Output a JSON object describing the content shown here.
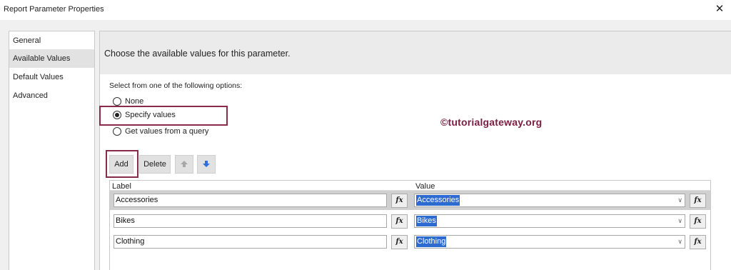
{
  "window": {
    "title": "Report Parameter Properties",
    "close_glyph": "✕"
  },
  "nav": {
    "items": [
      {
        "label": "General"
      },
      {
        "label": "Available Values"
      },
      {
        "label": "Default Values"
      },
      {
        "label": "Advanced"
      }
    ],
    "selected": "Available Values"
  },
  "panel": {
    "heading": "Choose the available values for this parameter.",
    "instruction": "Select from one of the following options:",
    "options": [
      {
        "label": "None",
        "checked": false
      },
      {
        "label": "Specify values",
        "checked": true
      },
      {
        "label": "Get values from a query",
        "checked": false
      }
    ]
  },
  "watermark": "©tutorialgateway.org",
  "toolbar": {
    "add_label": "Add",
    "delete_label": "Delete",
    "move_up_icon": "up-arrow-icon",
    "move_down_icon": "down-arrow-icon"
  },
  "grid": {
    "columns": [
      "Label",
      "Value"
    ],
    "fx_label": "fx",
    "rows": [
      {
        "label": "Accessories",
        "value": "Accessories"
      },
      {
        "label": "Bikes",
        "value": "Bikes"
      },
      {
        "label": "Clothing",
        "value": "Clothing"
      }
    ]
  },
  "colors": {
    "highlight_border": "#8a2b4a",
    "selection": "#2d6ad1",
    "watermark": "#7a2040"
  }
}
